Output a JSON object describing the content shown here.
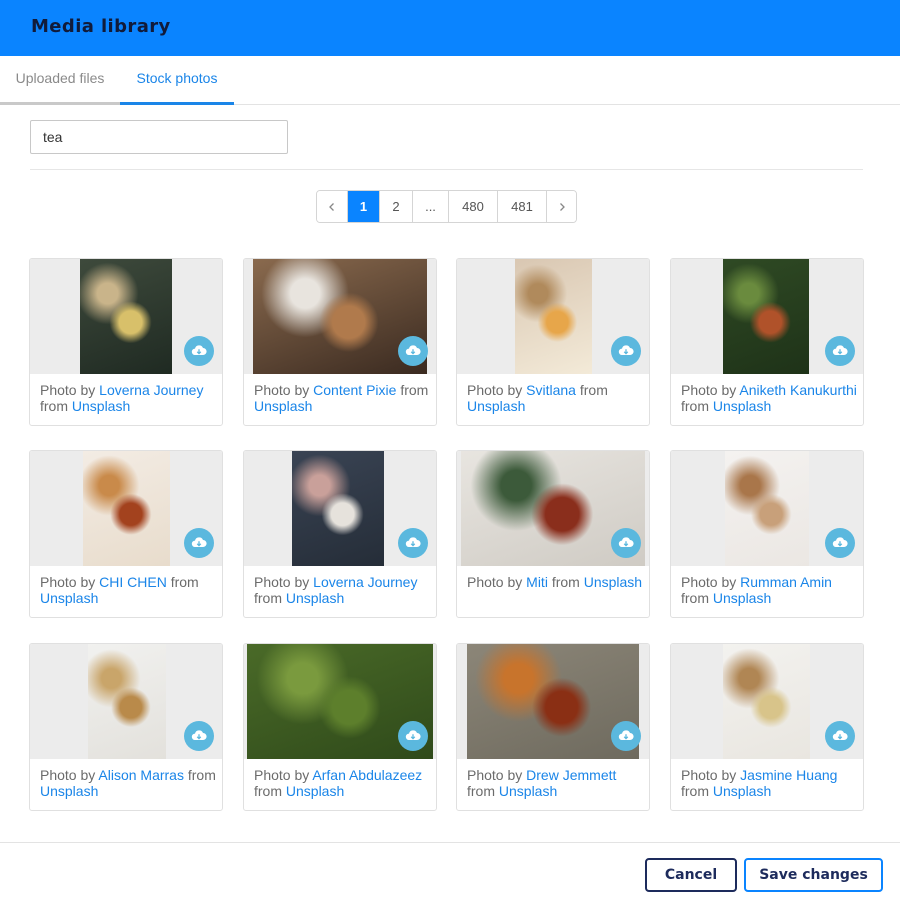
{
  "header": {
    "title": "Media library"
  },
  "tabs": [
    {
      "label": "Uploaded files",
      "active": false
    },
    {
      "label": "Stock photos",
      "active": true
    }
  ],
  "search": {
    "value": "tea",
    "placeholder": ""
  },
  "pagination": {
    "prev_icon": "chevron-left-icon",
    "pages": [
      "1",
      "2",
      "...",
      "480",
      "481"
    ],
    "current": "1",
    "next_icon": "chevron-right-icon"
  },
  "caption": {
    "prefix": "Photo by ",
    "middle": " from ",
    "source": "Unsplash"
  },
  "download_icon": "cloud-download-icon",
  "photos": [
    {
      "author": "Loverna Journey",
      "colors": [
        "#3e4a3c",
        "#1f2a22",
        "#c9b48a",
        "#d8c06a"
      ]
    },
    {
      "author": "Content Pixie",
      "colors": [
        "#8a6a4e",
        "#3a2a20",
        "#e8e4de",
        "#b07a4c"
      ]
    },
    {
      "author": "Svitlana",
      "colors": [
        "#d9c7b2",
        "#f3ead8",
        "#b08a5c",
        "#e7a64a"
      ]
    },
    {
      "author": "Aniketh Kanukurthi",
      "colors": [
        "#2f4a24",
        "#1e3218",
        "#6a8b3e",
        "#b0522a"
      ]
    },
    {
      "author": "CHI CHEN",
      "colors": [
        "#f3ece4",
        "#e8dccc",
        "#c98a4a",
        "#a3421e"
      ]
    },
    {
      "author": "Loverna Journey",
      "colors": [
        "#3a4454",
        "#252d38",
        "#c9a09a",
        "#e6e2dc"
      ]
    },
    {
      "author": "Miti",
      "colors": [
        "#e8e5e0",
        "#cfcbc4",
        "#3c5a3a",
        "#8a2e1c"
      ]
    },
    {
      "author": "Rumman Amin",
      "colors": [
        "#f4f2f0",
        "#ebe7e3",
        "#a9764a",
        "#c8a07a"
      ]
    },
    {
      "author": "Alison Marras",
      "colors": [
        "#f1f1ef",
        "#e3e1dc",
        "#c9a56a",
        "#b98a4a"
      ]
    },
    {
      "author": "Arfan Abdulazeez",
      "colors": [
        "#4a6a28",
        "#2f4a1a",
        "#7a9a3e",
        "#5d7f2c"
      ]
    },
    {
      "author": "Drew Jemmett",
      "colors": [
        "#8c8678",
        "#6e6a5e",
        "#c8742c",
        "#8a2f14"
      ]
    },
    {
      "author": "Jasmine Huang",
      "colors": [
        "#f3f2ef",
        "#e9e6e0",
        "#b08654",
        "#d8c48a"
      ]
    }
  ],
  "footer": {
    "cancel_label": "Cancel",
    "save_label": "Save changes"
  }
}
